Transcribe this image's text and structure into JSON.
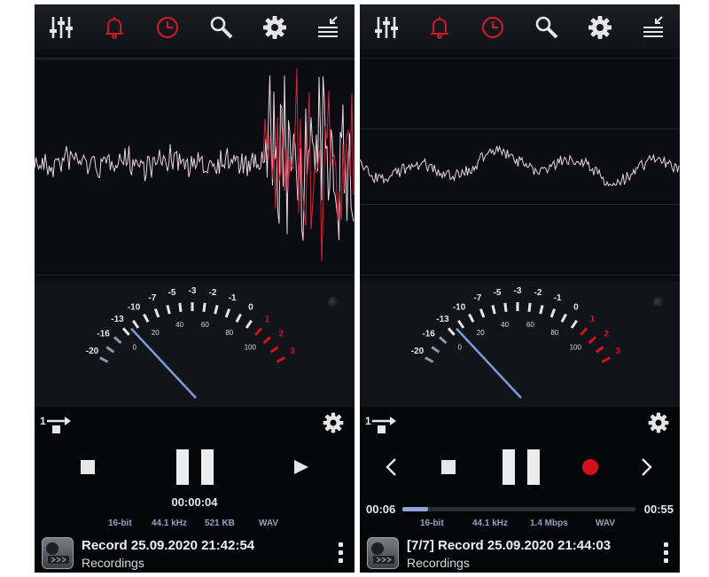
{
  "colors": {
    "accent_red": "#d4101f",
    "wave_white": "#e8d4dc",
    "wave_red": "#d3263e",
    "needle_blue": "#7d9bd8",
    "info_blue": "#8fa3c9"
  },
  "toolbar": {
    "icons": [
      "equalizer-icon",
      "bell-icon",
      "clock-icon",
      "search-icon",
      "gear-icon",
      "sort-icon"
    ]
  },
  "meter": {
    "scale_outer": [
      "-20",
      "-16",
      "-13",
      "-10",
      "-7",
      "-5",
      "-3",
      "-2",
      "-1",
      "0",
      "1",
      "2",
      "3"
    ],
    "scale_inner": [
      "0",
      "20",
      "40",
      "60",
      "80",
      "100"
    ]
  },
  "left": {
    "time": "00:00:04",
    "info": {
      "bits": "16-bit",
      "rate": "44.1 kHz",
      "size": "521 KB",
      "format": "WAV"
    },
    "record_title": "Record 25.09.2020 21:42:54",
    "record_folder": "Recordings"
  },
  "right": {
    "time_elapsed": "00:06",
    "time_total": "00:55",
    "progress": 0.11,
    "info": {
      "bits": "16-bit",
      "rate": "44.1 kHz",
      "bitrate": "1.4 Mbps",
      "format": "WAV"
    },
    "record_title": "[7/7] Record 25.09.2020 21:44:03",
    "record_folder": "Recordings"
  }
}
